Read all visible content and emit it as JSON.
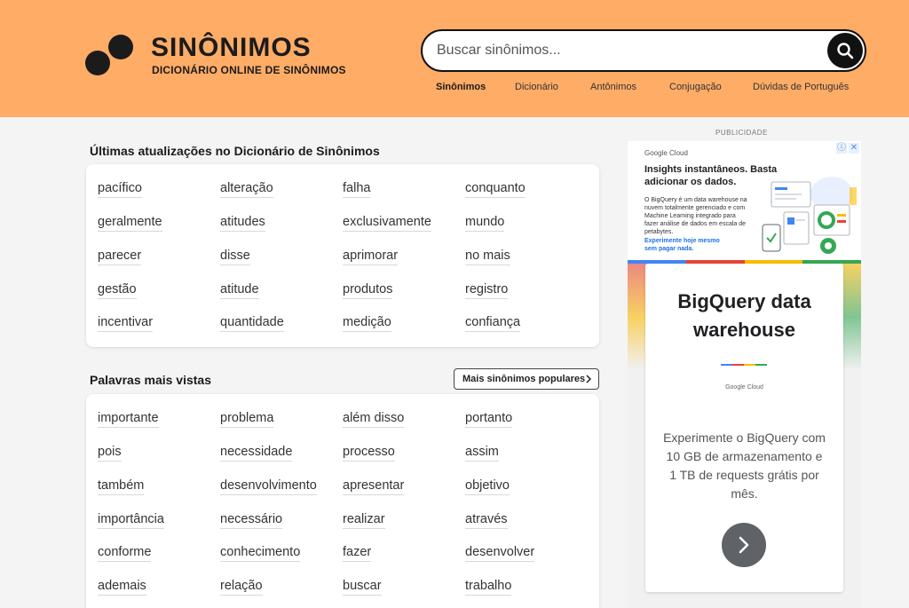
{
  "header": {
    "logo_title": "SINÔNIMOS",
    "logo_subtitle": "DICIONÁRIO ONLINE DE SINÔNIMOS",
    "search_placeholder": "Buscar sinônimos...",
    "nav": [
      "Sinônimos",
      "Dicionário",
      "Antônimos",
      "Conjugação",
      "Dúvidas de Português"
    ],
    "active_nav": "Sinônimos"
  },
  "latest": {
    "title": "Últimas atualizações no Dicionário de Sinônimos",
    "words": [
      "pacífico",
      "alteração",
      "falha",
      "conquanto",
      "geralmente",
      "atitudes",
      "exclusivamente",
      "mundo",
      "parecer",
      "disse",
      "aprimorar",
      "no mais",
      "gestão",
      "atitude",
      "produtos",
      "registro",
      "incentivar",
      "quantidade",
      "medição",
      "confiança"
    ]
  },
  "popular": {
    "title": "Palavras mais vistas",
    "more_button": "Mais sinônimos populares",
    "words": [
      "importante",
      "problema",
      "além disso",
      "portanto",
      "pois",
      "necessidade",
      "processo",
      "assim",
      "também",
      "desenvolvimento",
      "apresentar",
      "objetivo",
      "importância",
      "necessário",
      "realizar",
      "através",
      "conforme",
      "conhecimento",
      "fazer",
      "desenvolver",
      "ademais",
      "relação",
      "buscar",
      "trabalho"
    ]
  },
  "ad": {
    "label": "PUBLICIDADE",
    "brand": "Google Cloud",
    "headline": "Insights instantâneos. Basta adicionar os dados.",
    "body": "O BigQuery é um data warehouse na nuvem totalmente gerenciado e com Machine Learning integrado para fazer análise de dados em escala de petabytes.",
    "link": "Experimente hoje mesmo sem pagar nada.",
    "card_title": "BigQuery data warehouse",
    "card_brand": "Google Cloud",
    "card_description": "Experimente o BigQuery com 10 GB de armazenamento e 1 TB de requests grátis por mês."
  },
  "colors": {
    "header_bg": "#ffac66",
    "google_blue": "#4285f4",
    "google_red": "#ea4335",
    "google_yellow": "#fbbc04",
    "google_green": "#34a853"
  },
  "icons": {
    "search": "search-icon",
    "more": "chevron-right-icon",
    "ad_arrow": "arrow-right-icon",
    "ad_info": "info-icon",
    "ad_close": "close-icon"
  }
}
